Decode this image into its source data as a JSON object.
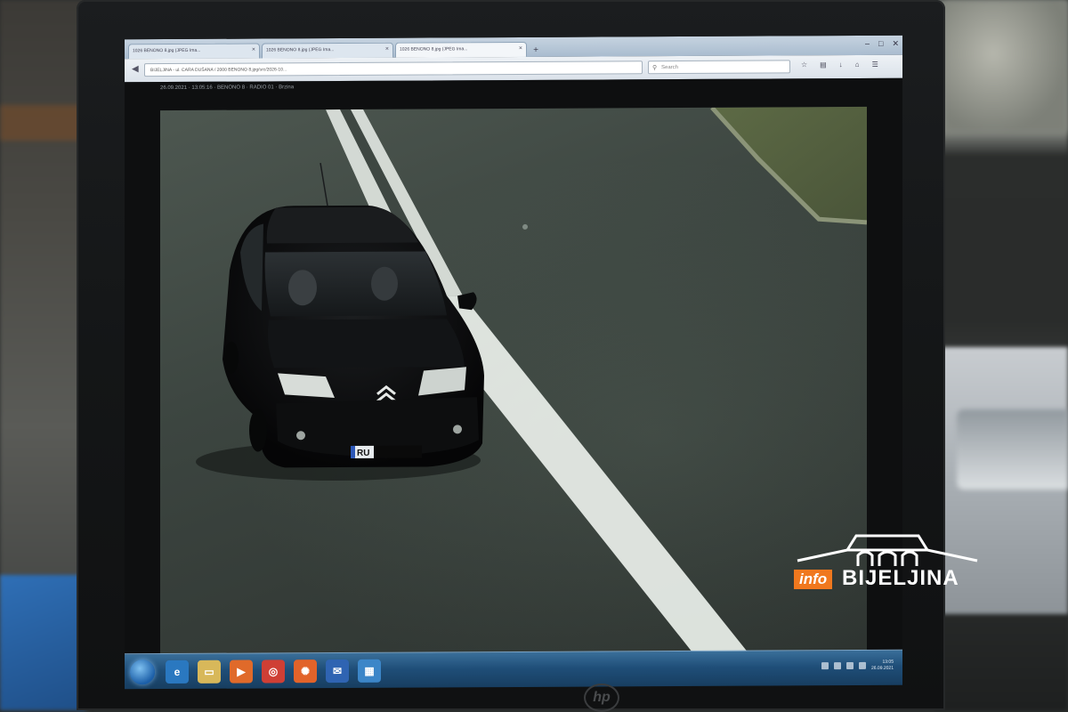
{
  "browser": {
    "tabs": [
      {
        "label": "1026 BENONO 8.jpg (JPEG Ima..."
      },
      {
        "label": "1026 BENONO 8.jpg (JPEG Ima..."
      },
      {
        "label": "1026 BENONO 8.jpg (JPEG Ima...",
        "active": true
      }
    ],
    "url": "BIJELJINA - ul. CARA DUŠANA / 2000 BENONO 8.jpg/src/2026-10...",
    "search_placeholder": "Search"
  },
  "page": {
    "caption": "26.09.2021 · 13:05:16 · BENONO 8 · RADIO 01 · Brzina"
  },
  "photo": {
    "subject": "black hatchback car on road with lane markings",
    "plate_visible_text": "RU"
  },
  "taskbar": {
    "clock_time": "13:05",
    "clock_date": "26.09.2021"
  },
  "watermark": {
    "badge": "info",
    "name": "BIJELJINA"
  },
  "colors": {
    "watermark_accent": "#f0781e",
    "taskbar": "#1f4e78"
  }
}
